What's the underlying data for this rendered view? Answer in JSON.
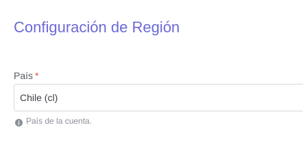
{
  "section": {
    "title": "Configuración de Región"
  },
  "country_field": {
    "label": "País",
    "required_marker": "*",
    "selected_value": "Chile (cl)",
    "help_text": "País de la cuenta."
  },
  "icons": {
    "help": "info-circle-icon"
  },
  "colors": {
    "title": "#6c6ad6",
    "required": "#e0533f",
    "help_text": "#8a8f97",
    "border": "#d6d9de"
  }
}
